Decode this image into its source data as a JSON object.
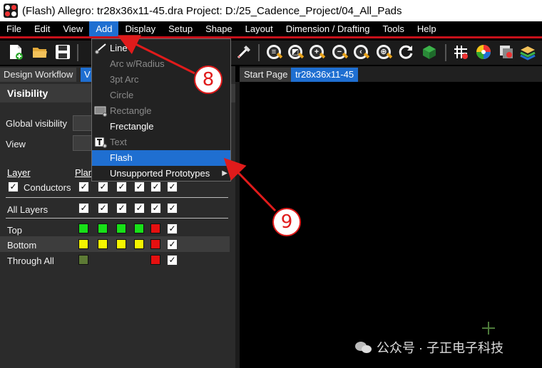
{
  "titlebar": {
    "title": "(Flash) Allegro: tr28x36x11-45.dra  Project: D:/25_Cadence_Project/04_All_Pads"
  },
  "menubar": {
    "items": [
      "File",
      "Edit",
      "View",
      "Add",
      "Display",
      "Setup",
      "Shape",
      "Layout",
      "Dimension / Drafting",
      "Tools",
      "Help"
    ],
    "active": "Add"
  },
  "tabs": {
    "design_workflow": "Design Workflow",
    "visibility_short": "V",
    "start_page": "Start Page",
    "file_tab": "tr28x36x11-45"
  },
  "panel": {
    "title": "Visibility",
    "global_visibility": "Global visibility",
    "view": "View",
    "header_layer": "Layer",
    "header_plan": "Plan",
    "rows": [
      {
        "label": "Conductors"
      },
      {
        "label": "All Layers"
      },
      {
        "label": "Top"
      },
      {
        "label": "Bottom"
      },
      {
        "label": "Through All"
      }
    ],
    "colors": {
      "green": "#18e018",
      "yellow": "#f5f500",
      "red": "#e51010",
      "olive": "#5d7a35"
    }
  },
  "dropdown": {
    "items": [
      {
        "label": "Line",
        "enabled": true
      },
      {
        "label": "Arc w/Radius",
        "enabled": false
      },
      {
        "label": "3pt Arc",
        "enabled": false
      },
      {
        "label": "Circle",
        "enabled": false
      },
      {
        "label": "Rectangle",
        "enabled": false
      },
      {
        "label": "Frectangle",
        "enabled": true
      },
      {
        "label": "Text",
        "enabled": false
      },
      {
        "label": "Flash",
        "enabled": true,
        "highlighted": true
      },
      {
        "label": "Unsupported Prototypes",
        "enabled": true,
        "submenu": true
      }
    ]
  },
  "annotations": {
    "callout_8": "8",
    "callout_9": "9"
  },
  "watermark": {
    "text": "公众号 · 子正电子科技"
  },
  "accent": "#1f6fd1",
  "annotation_color": "#e01b1b"
}
